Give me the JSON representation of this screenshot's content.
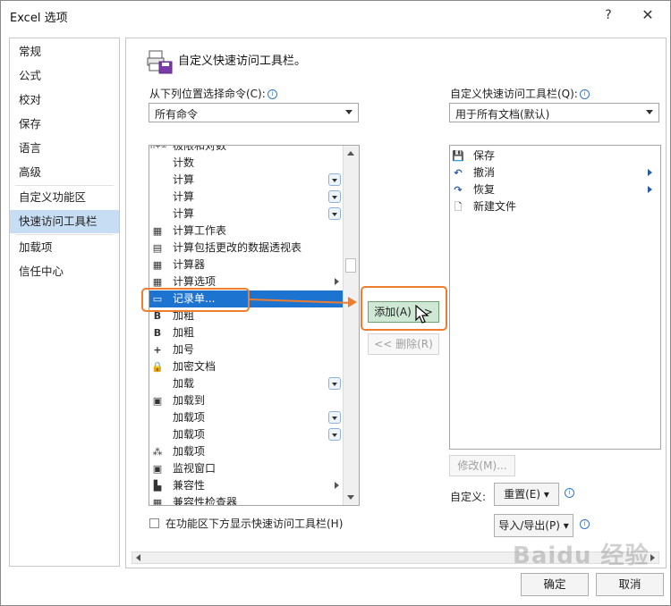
{
  "window": {
    "title": "Excel 选项",
    "help": "?",
    "close": "✕"
  },
  "nav": {
    "items": [
      {
        "label": "常规"
      },
      {
        "label": "公式"
      },
      {
        "label": "校对"
      },
      {
        "label": "保存"
      },
      {
        "label": "语言"
      },
      {
        "label": "高级"
      },
      {
        "label": "自定义功能区"
      },
      {
        "label": "快速访问工具栏",
        "active": true
      },
      {
        "label": "加载项"
      },
      {
        "label": "信任中心"
      }
    ]
  },
  "main": {
    "header": "自定义快速访问工具栏。",
    "choose_label": "从下列位置选择命令(C):",
    "choose_value": "所有命令",
    "customize_label": "自定义快速访问工具栏(Q):",
    "customize_value": "用于所有文档(默认)",
    "commands": [
      {
        "label": "极限和对数",
        "icon": "n+∞"
      },
      {
        "label": "计数",
        "icon": ""
      },
      {
        "label": "计算",
        "icon": "",
        "dropdown": true
      },
      {
        "label": "计算",
        "icon": "",
        "dropdown": true
      },
      {
        "label": "计算",
        "icon": "",
        "dropdown": true
      },
      {
        "label": "计算工作表",
        "icon": "▦"
      },
      {
        "label": "计算包括更改的数据透视表",
        "icon": "▤"
      },
      {
        "label": "计算器",
        "icon": "▦"
      },
      {
        "label": "计算选项",
        "icon": "▦",
        "submenu": true
      },
      {
        "label": "记录单...",
        "icon": "▭",
        "selected": true
      },
      {
        "label": "加粗",
        "icon": "B"
      },
      {
        "label": "加粗",
        "icon": "B"
      },
      {
        "label": "加号",
        "icon": "+"
      },
      {
        "label": "加密文档",
        "icon": "🔒"
      },
      {
        "label": "加载",
        "icon": "",
        "dropdown": true
      },
      {
        "label": "加载到",
        "icon": "▣"
      },
      {
        "label": "加载项",
        "icon": "",
        "dropdown": true
      },
      {
        "label": "加载项",
        "icon": "",
        "dropdown": true
      },
      {
        "label": "加载项",
        "icon": "⁂"
      },
      {
        "label": "监视窗口",
        "icon": "▣"
      },
      {
        "label": "兼容性",
        "icon": "▙",
        "submenu": true
      },
      {
        "label": "兼容性检查器",
        "icon": "▦"
      }
    ],
    "qat_items": [
      {
        "label": "保存",
        "icon": "💾"
      },
      {
        "label": "撤消",
        "icon": "↶",
        "submenu": true
      },
      {
        "label": "恢复",
        "icon": "↷",
        "submenu": true
      },
      {
        "label": "新建文件",
        "icon": "🗋"
      }
    ],
    "add_button": "添加(A) >>",
    "remove_button": "<< 删除(R)",
    "modify_button": "修改(M)...",
    "customize_text": "自定义:",
    "reset_button": "重置(E) ▾",
    "import_export_button": "导入/导出(P) ▾",
    "show_below_ribbon": "在功能区下方显示快速访问工具栏(H)"
  },
  "footer": {
    "ok": "确定",
    "cancel": "取消"
  },
  "watermark": "Baidu 经验",
  "colors": {
    "selection": "#1c73d0",
    "highlight": "#ef7d2f",
    "nav_active": "#c7ddf3",
    "add_button": "#cfe8d4"
  }
}
